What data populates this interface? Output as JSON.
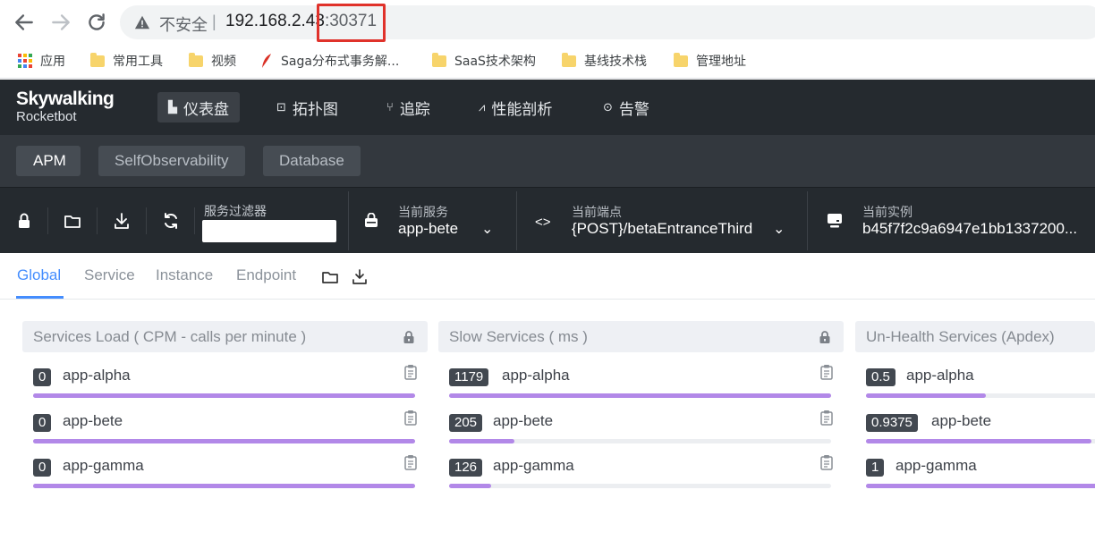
{
  "browser": {
    "insecure_label": "不安全",
    "separator": "|",
    "url_host": "192.168.2.43",
    "url_port": ":30371"
  },
  "bookmarks": [
    {
      "label": "应用",
      "icon": "apps-grid-icon"
    },
    {
      "label": "常用工具",
      "icon": "folder-icon"
    },
    {
      "label": "视频",
      "icon": "folder-icon"
    },
    {
      "label": "Saga分布式事务解...",
      "icon": "feather-icon"
    },
    {
      "label": "SaaS技术架构",
      "icon": "folder-icon"
    },
    {
      "label": "基线技术栈",
      "icon": "folder-icon"
    },
    {
      "label": "管理地址",
      "icon": "folder-icon"
    }
  ],
  "app": {
    "logo_line1": "Skywalking",
    "logo_line2": "Rocketbot",
    "nav": [
      {
        "label": "仪表盘",
        "icon": "chart-icon",
        "active": true
      },
      {
        "label": "拓扑图",
        "icon": "topology-icon"
      },
      {
        "label": "追踪",
        "icon": "trace-icon"
      },
      {
        "label": "性能剖析",
        "icon": "profile-icon"
      },
      {
        "label": "告警",
        "icon": "alarm-icon"
      }
    ],
    "layers": [
      "APM",
      "SelfObservability",
      "Database"
    ],
    "toolbar": {
      "filter_label": "服务过滤器",
      "filter_value": "",
      "service_label": "当前服务",
      "service_value": "app-bete",
      "endpoint_label": "当前端点",
      "endpoint_value": "{POST}/betaEntranceThird",
      "instance_label": "当前实例",
      "instance_value": "b45f7f2c9a6947e1bb1337200..."
    }
  },
  "dashboard_tabs": [
    "Global",
    "Service",
    "Instance",
    "Endpoint"
  ],
  "panels": [
    {
      "title": "Services Load ( CPM - calls per minute )",
      "rows": [
        {
          "value": "0",
          "name": "app-alpha",
          "fraction": 1.0
        },
        {
          "value": "0",
          "name": "app-bete",
          "fraction": 1.0
        },
        {
          "value": "0",
          "name": "app-gamma",
          "fraction": 1.0
        }
      ]
    },
    {
      "title": "Slow Services ( ms )",
      "rows": [
        {
          "value": "1179",
          "name": "app-alpha",
          "fraction": 1.0
        },
        {
          "value": "205",
          "name": "app-bete",
          "fraction": 0.17
        },
        {
          "value": "126",
          "name": "app-gamma",
          "fraction": 0.11
        }
      ]
    },
    {
      "title": "Un-Health Services (Apdex)",
      "rows": [
        {
          "value": "0.5",
          "name": "app-alpha",
          "fraction": 0.5
        },
        {
          "value": "0.9375",
          "name": "app-bete",
          "fraction": 0.94
        },
        {
          "value": "1",
          "name": "app-gamma",
          "fraction": 1.0
        }
      ]
    }
  ],
  "colors": {
    "accent": "#448dfe",
    "bar": "#b288e8",
    "header_bg": "#252a2f",
    "highlight_box": "#e0322b"
  }
}
